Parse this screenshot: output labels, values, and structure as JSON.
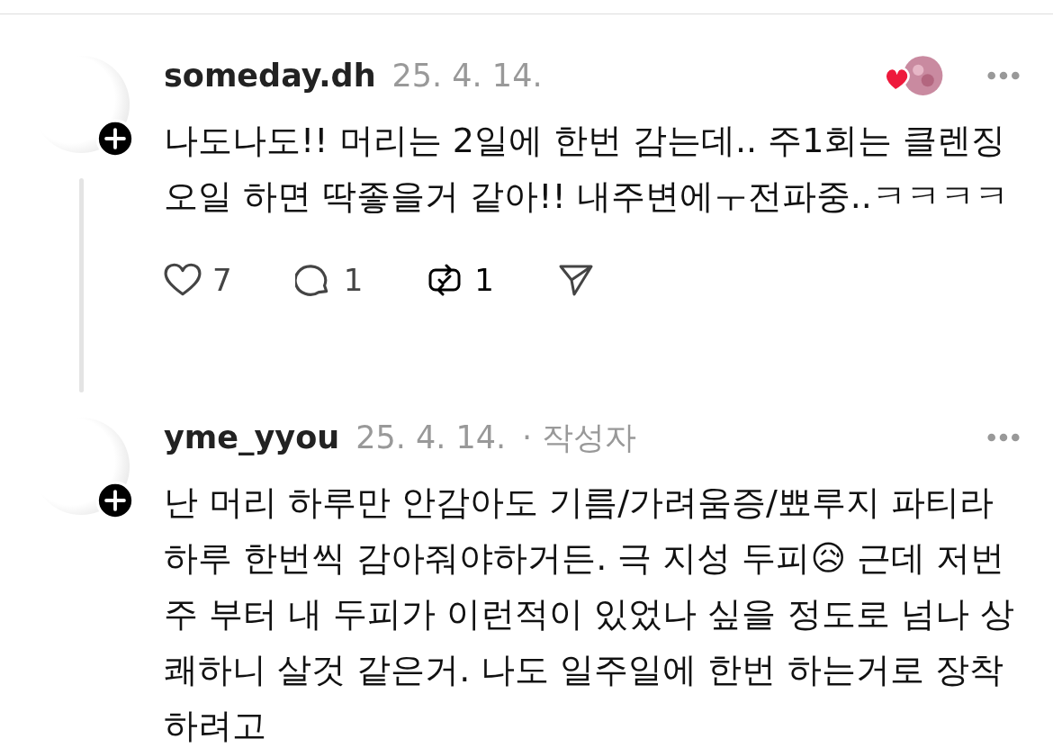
{
  "comments": [
    {
      "username": "someday.dh",
      "date": "25. 4. 14.",
      "author_liked": true,
      "text": "나도나도!! 머리는 2일에 한번 감는데.. 주1회는 클렌징 오일 하면 딱좋을거 같아!! 내주변에ㅜ전파중..ㅋㅋㅋㅋ",
      "thread_line": true,
      "actions": {
        "likes": "7",
        "replies": "1",
        "reposts": "1",
        "reposted": true
      }
    },
    {
      "username": "yme_yyou",
      "date": "25. 4. 14.",
      "badge": "· 작성자",
      "author_liked": false,
      "text": "난 머리 하루만 안감아도 기름/가려움증/뾰루지 파티라 하루 한번씩 감아줘야하거든. 극 지성 두피😥 근데 저번주 부터 내 두피가 이런적이 있었나 싶을 정도로 넘나 상쾌하니 살것 같은거. 나도 일주일에 한번 하는거로 장착 하려고",
      "thread_line": false
    }
  ]
}
